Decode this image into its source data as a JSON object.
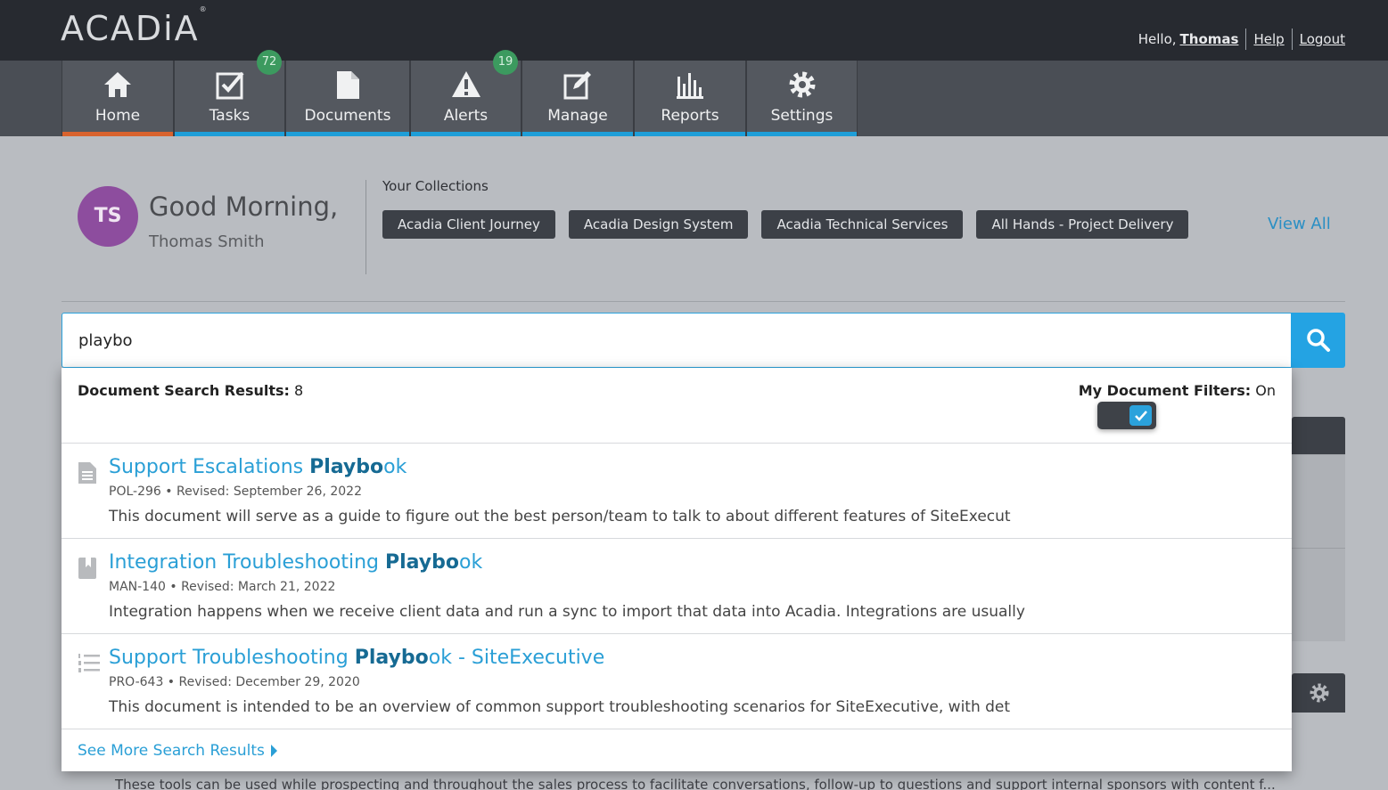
{
  "header": {
    "logo": "ACADiA",
    "logo_mark": "®",
    "hello_prefix": "Hello,",
    "user_first_name": "Thomas",
    "help_label": "Help",
    "logout_label": "Logout"
  },
  "nav": {
    "items": [
      {
        "label": "Home",
        "icon": "home-icon",
        "active": true
      },
      {
        "label": "Tasks",
        "icon": "checkbox-icon",
        "badge": "72"
      },
      {
        "label": "Documents",
        "icon": "document-icon"
      },
      {
        "label": "Alerts",
        "icon": "warning-icon",
        "badge": "19"
      },
      {
        "label": "Manage",
        "icon": "edit-icon"
      },
      {
        "label": "Reports",
        "icon": "bar-chart-icon"
      },
      {
        "label": "Settings",
        "icon": "gear-icon"
      }
    ],
    "colors": {
      "active_bar": "#d9632e",
      "bar": "#1e9ed8",
      "badge": "#3c9a5f"
    }
  },
  "greeting": {
    "initials": "TS",
    "avatar_color": "#8d4d9e",
    "salutation": "Good Morning,",
    "full_name": "Thomas Smith"
  },
  "collections": {
    "title": "Your Collections",
    "items": [
      "Acadia Client Journey",
      "Acadia Design System",
      "Acadia Technical Services",
      "All Hands - Project Delivery"
    ],
    "view_all": "View All"
  },
  "search": {
    "query": "playbo",
    "icon": "search-icon"
  },
  "results": {
    "count_label": "Document Search Results:",
    "count": "8",
    "filter_label": "My Document Filters:",
    "filter_state": "On",
    "filter_enabled": true,
    "items": [
      {
        "icon": "document-lines-icon",
        "title_before": "Support Escalations ",
        "title_match": "Playbo",
        "title_after": "ok",
        "code": "POL-296",
        "revised": "Revised: September 26, 2022",
        "description": "This document will serve as a guide to figure out the best person/team to talk to about different features of SiteExecut"
      },
      {
        "icon": "bookmark-doc-icon",
        "title_before": "Integration Troubleshooting ",
        "title_match": "Playbo",
        "title_after": "ok",
        "code": "MAN-140",
        "revised": "Revised: March 21, 2022",
        "description": "Integration happens when we receive client data and run a sync to import that data into Acadia. Integrations are usually"
      },
      {
        "icon": "numbered-list-icon",
        "title_before": "Support Troubleshooting ",
        "title_match": "Playbo",
        "title_after": "ok - SiteExecutive",
        "code": "PRO-643",
        "revised": "Revised: December 29, 2020",
        "description": "This document is intended to be an overview of common support troubleshooting scenarios for SiteExecutive, with det"
      }
    ],
    "see_more": "See More Search Results"
  },
  "background": {
    "tools_text": "These tools can be used while prospecting and throughout the sales process to facilitate conversations, follow-up to questions and support internal sponsors with content f..."
  }
}
